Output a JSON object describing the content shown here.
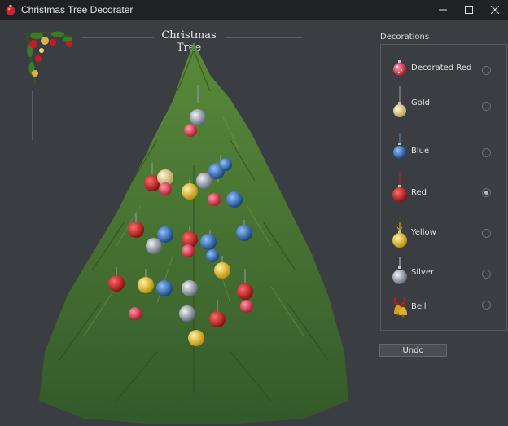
{
  "window": {
    "title": "Christmas Tree Decorater",
    "icon": "ornament-icon",
    "controls": [
      "minimize-icon",
      "maximize-icon",
      "close-icon"
    ]
  },
  "canvas": {
    "title": "Christmas Tree"
  },
  "decorations": {
    "label": "Decorations",
    "selected": "Red",
    "items": [
      {
        "label": "Decorated Red",
        "icon": "decorated-red-ornament-icon",
        "selected": false,
        "color": "#d8202a"
      },
      {
        "label": "Gold",
        "icon": "gold-ornament-icon",
        "selected": false,
        "color": "#d9b24a"
      },
      {
        "label": "Blue",
        "icon": "blue-ornament-icon",
        "selected": false,
        "color": "#2a6fbf"
      },
      {
        "label": "Red",
        "icon": "red-ornament-icon",
        "selected": true,
        "color": "#c8101a"
      },
      {
        "label": "Yellow",
        "icon": "yellow-ornament-icon",
        "selected": false,
        "color": "#e6b800"
      },
      {
        "label": "Silver",
        "icon": "silver-ornament-icon",
        "selected": false,
        "color": "#9aa6b2"
      },
      {
        "label": "Bell",
        "icon": "bell-icon",
        "selected": false,
        "color": "#d4a020"
      }
    ]
  },
  "actions": {
    "undo_label": "Undo"
  },
  "colors": {
    "background": "#3a3d42",
    "titlebar": "#1f2125",
    "tree_green": "#3f6b2a"
  }
}
